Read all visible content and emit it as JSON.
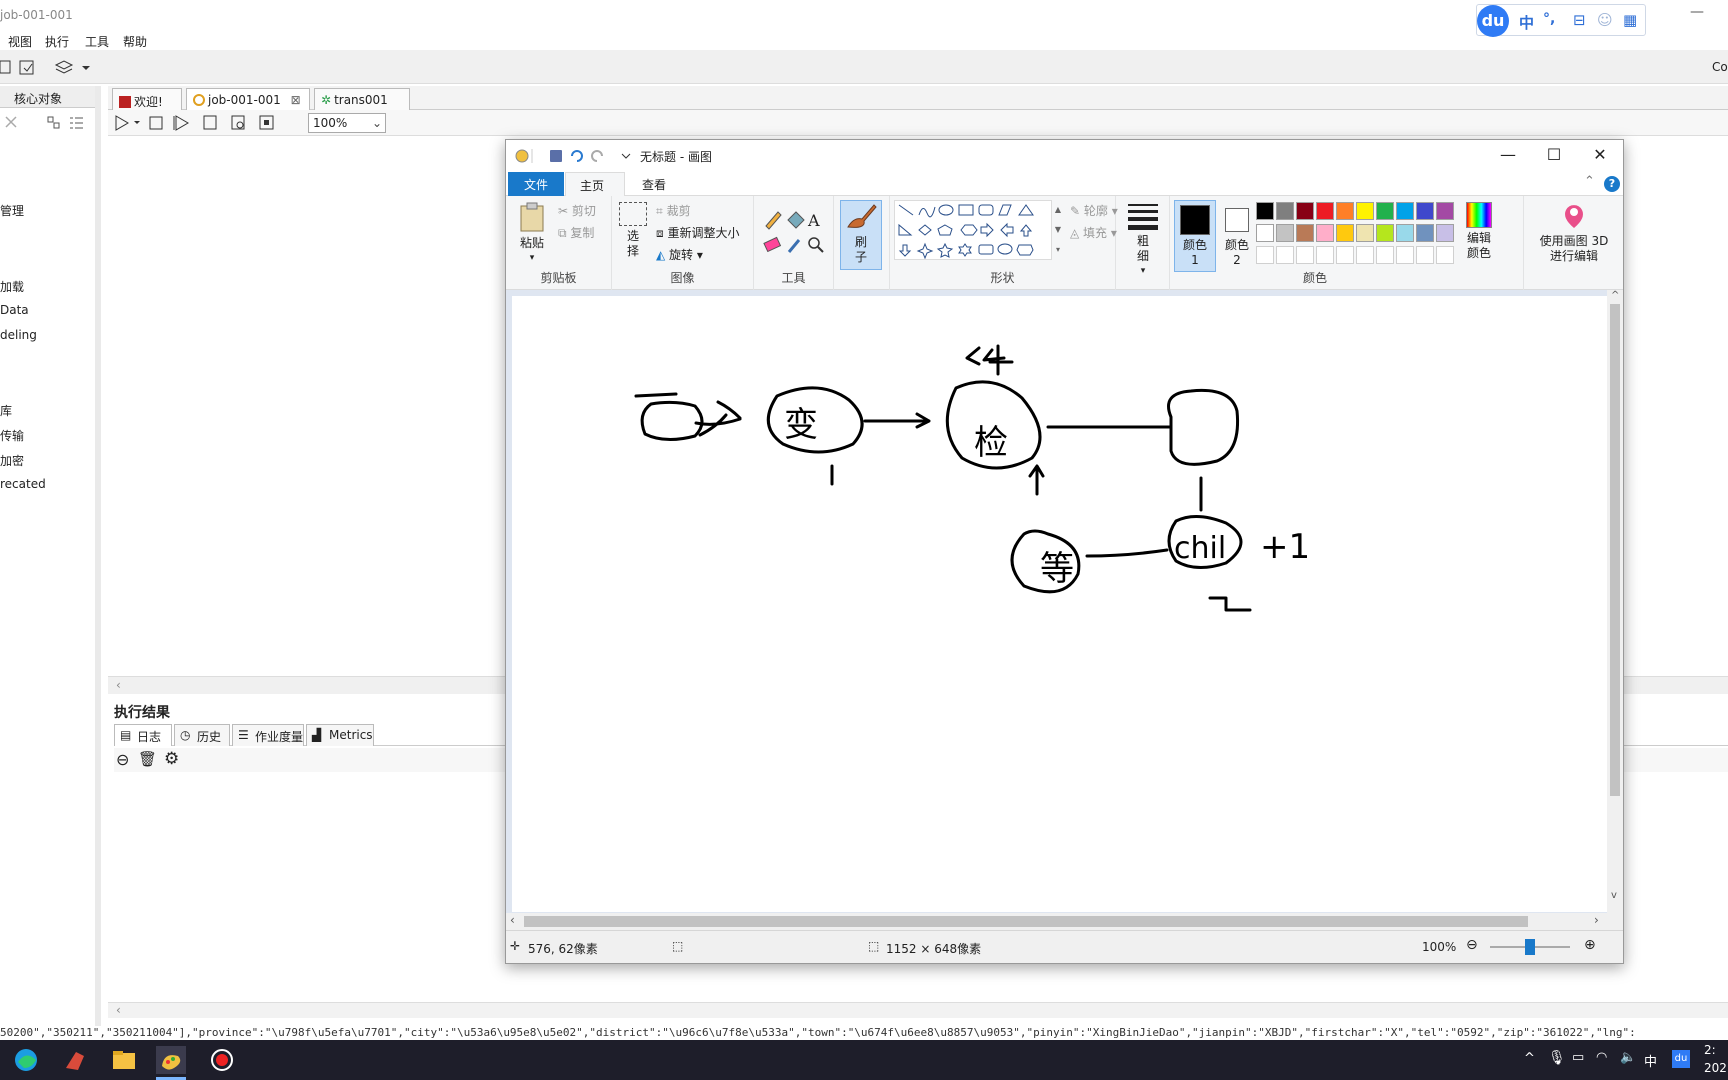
{
  "kettle": {
    "title": "job-001-001",
    "menu": [
      "视图",
      "执行",
      "工具",
      "帮助"
    ],
    "right_corner_text": "Co",
    "left_panel": {
      "tab_label": "核心对象",
      "tree_items": [
        "管理",
        "加载",
        "Data",
        "deling",
        "库",
        "传输",
        "加密",
        "recated"
      ]
    },
    "tabs": [
      {
        "label": "欢迎!"
      },
      {
        "label": "job-001-001"
      },
      {
        "label": "trans001"
      }
    ],
    "zoom_value": "100%",
    "results": {
      "title": "执行结果",
      "tabs": [
        "日志",
        "历史",
        "作业度量",
        "Metrics"
      ]
    },
    "json_line": "50200\",\"350211\",\"350211004\"],\"province\":\"\\u798f\\u5efa\\u7701\",\"city\":\"\\u53a6\\u95e8\\u5e02\",\"district\":\"\\u96c6\\u7f8e\\u533a\",\"town\":\"\\u674f\\u6ee8\\u8857\\u9053\",\"pinyin\":\"XingBinJieDao\",\"jianpin\":\"XBJD\",\"firstchar\":\"X\",\"tel\":\"0592\",\"zip\":\"361022\",\"lng\":"
  },
  "ime": {
    "logo": "du",
    "mode": "中",
    "punct": "°,"
  },
  "paint": {
    "title": "无标题 - 画图",
    "window_buttons": {
      "minimize": "—",
      "maximize": "☐",
      "close": "✕"
    },
    "ribbon_tabs": {
      "file": "文件",
      "home": "主页",
      "view": "查看"
    },
    "clipboard": {
      "paste": "粘贴",
      "cut": "剪切",
      "copy": "复制",
      "label": "剪贴板"
    },
    "image": {
      "select": "选择",
      "crop": "裁剪",
      "resize": "重新调整大小",
      "rotate": "旋转",
      "label": "图像"
    },
    "tools": {
      "label": "工具"
    },
    "brush": {
      "label": "刷子"
    },
    "shapes": {
      "outline": "轮廓",
      "fill": "填充",
      "label": "形状"
    },
    "size": {
      "label": "粗细"
    },
    "colors": {
      "color1": "颜色 1",
      "color2": "颜色 2",
      "edit": "编辑颜色",
      "paint3d": "使用画图 3D 进行编辑",
      "label": "颜色",
      "row1": [
        "#000000",
        "#7f7f7f",
        "#880015",
        "#ed1c24",
        "#ff7f27",
        "#fff200",
        "#22b14c",
        "#00a2e8",
        "#3f48cc",
        "#a349a4"
      ],
      "row2": [
        "#ffffff",
        "#c3c3c3",
        "#b97a57",
        "#ffaec9",
        "#ffc90e",
        "#efe4b0",
        "#b5e61d",
        "#99d9ea",
        "#7092be",
        "#c8bfe7"
      ]
    },
    "drawing_texts": {
      "n1": "变",
      "n2": "检",
      "n3": "chil",
      "n4": "等",
      "top_mark": "<4",
      "right_mark": "+1",
      "under1": "1",
      "under2": "2"
    },
    "status": {
      "cursor": "576, 62像素",
      "canvas_size": "1152 × 648像素",
      "zoom": "100%"
    }
  },
  "taskbar": {
    "tray_time_1": "2:",
    "tray_time_2": "202",
    "ime_tray": "中"
  }
}
